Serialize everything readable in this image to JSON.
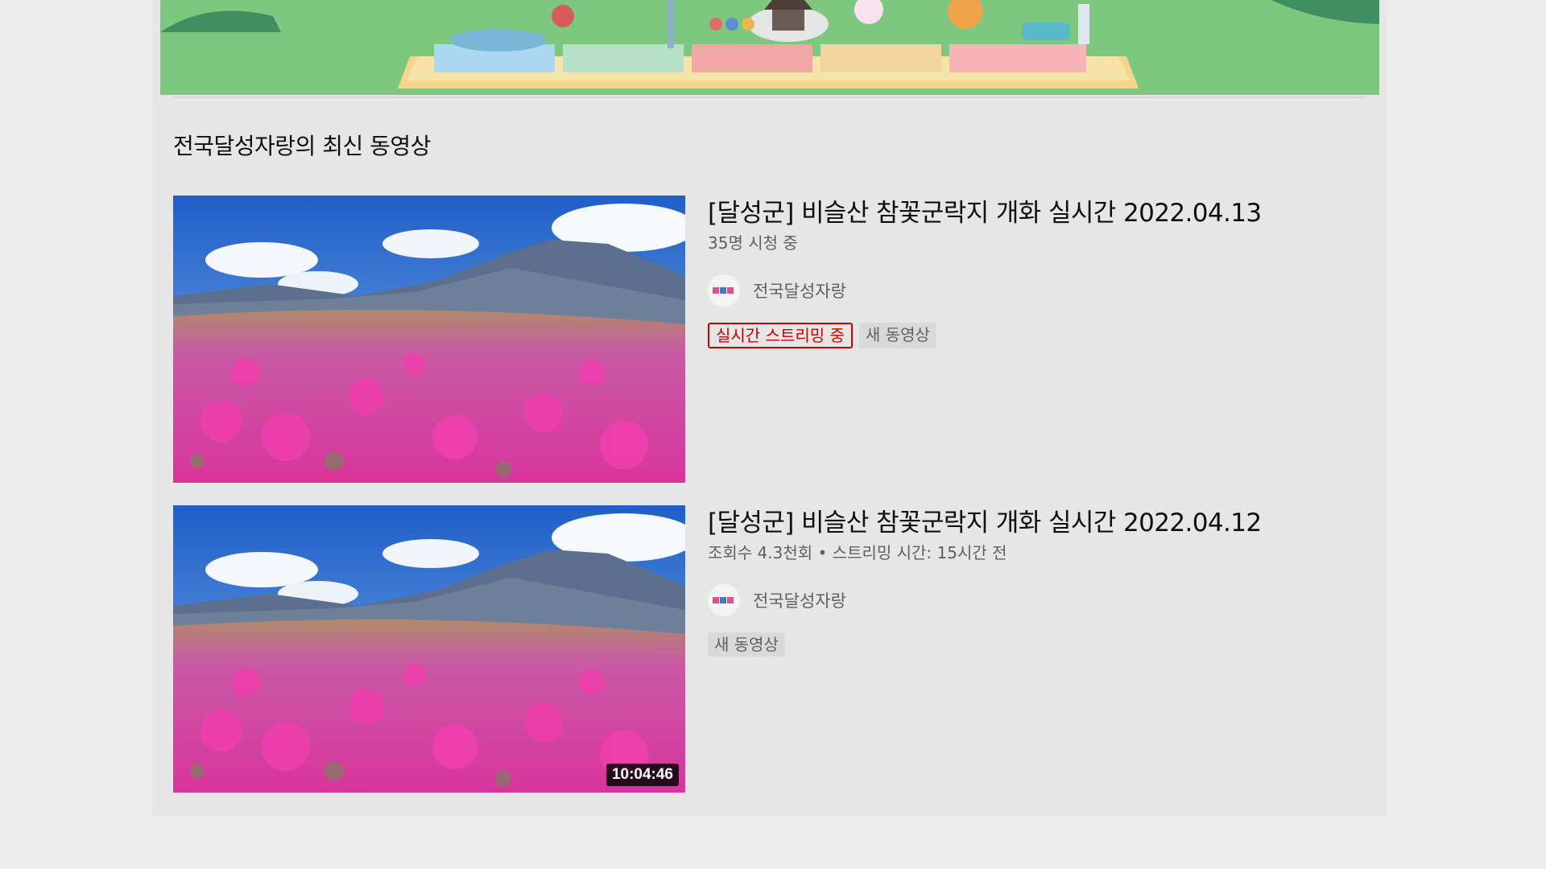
{
  "section": {
    "title": "전국달성자랑의 최신 동영상"
  },
  "videos": [
    {
      "title": "[달성군] 비슬산 참꽃군락지 개화 실시간 2022.04.13",
      "meta": "35명 시청 중",
      "channel": "전국달성자랑",
      "badges": {
        "live": "실시간 스트리밍 중",
        "new": "새 동영상"
      }
    },
    {
      "title": "[달성군] 비슬산 참꽃군락지 개화 실시간 2022.04.12",
      "meta": "조회수 4.3천회 • 스트리밍 시간: 15시간 전",
      "channel": "전국달성자랑",
      "duration": "10:04:46",
      "badges": {
        "new": "새 동영상"
      }
    }
  ],
  "colors": {
    "live_red": "#cc0000",
    "meta_gray": "#606060",
    "background": "#e6e6e6"
  }
}
